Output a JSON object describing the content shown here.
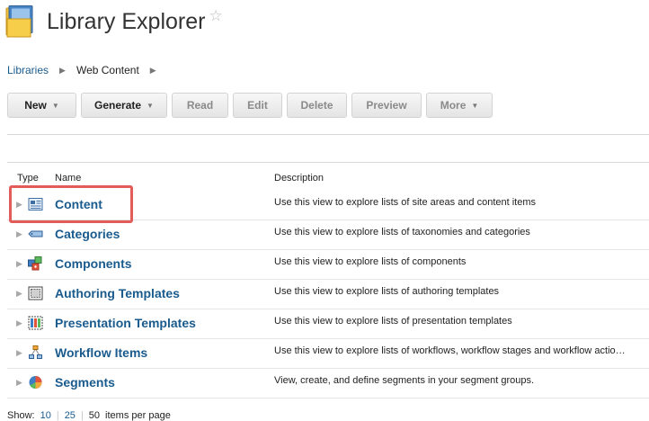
{
  "header": {
    "title": "Library Explorer"
  },
  "breadcrumb": {
    "items": [
      "Libraries",
      "Web Content"
    ]
  },
  "toolbar": {
    "new": "New",
    "generate": "Generate",
    "read": "Read",
    "edit": "Edit",
    "delete": "Delete",
    "preview": "Preview",
    "more": "More"
  },
  "table": {
    "columns": {
      "type": "Type",
      "name": "Name",
      "description": "Description"
    },
    "rows": [
      {
        "name": "Content",
        "icon": "content-icon",
        "description": "Use this view to explore lists of site areas and content items"
      },
      {
        "name": "Categories",
        "icon": "categories-icon",
        "description": "Use this view to explore lists of taxonomies and categories"
      },
      {
        "name": "Components",
        "icon": "components-icon",
        "description": "Use this view to explore lists of components"
      },
      {
        "name": "Authoring Templates",
        "icon": "authoring-templates-icon",
        "description": "Use this view to explore lists of authoring templates"
      },
      {
        "name": "Presentation Templates",
        "icon": "presentation-templates-icon",
        "description": "Use this view to explore lists of presentation templates"
      },
      {
        "name": "Workflow Items",
        "icon": "workflow-items-icon",
        "description": "Use this view to explore lists of workflows, workflow stages and workflow actio…"
      },
      {
        "name": "Segments",
        "icon": "segments-icon",
        "description": "View, create, and define segments in your segment groups."
      }
    ]
  },
  "pagination": {
    "label": "Show:",
    "options": [
      "10",
      "25",
      "50"
    ],
    "suffix": "items per page"
  },
  "colors": {
    "link": "#1a5b8e",
    "highlight": "#e25d5a"
  }
}
